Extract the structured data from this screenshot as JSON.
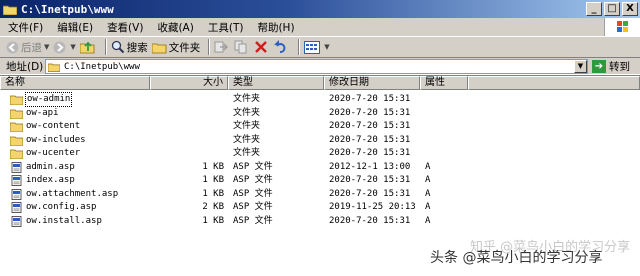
{
  "window": {
    "title": "C:\\Inetpub\\www",
    "minimize": "_",
    "maximize": "□",
    "close": "X"
  },
  "menu": [
    "文件(F)",
    "编辑(E)",
    "查看(V)",
    "收藏(A)",
    "工具(T)",
    "帮助(H)"
  ],
  "toolbar": {
    "back": "后退",
    "search": "搜索",
    "folders": "文件夹"
  },
  "address": {
    "label": "地址(D)",
    "value": "C:\\Inetpub\\www",
    "go": "转到"
  },
  "columns": {
    "name": "名称",
    "size": "大小",
    "type": "类型",
    "date": "修改日期",
    "attr": "属性"
  },
  "files": [
    {
      "name": "ow-admin",
      "size": "",
      "type": "文件夹",
      "date": "2020-7-20 15:31",
      "attr": "",
      "icon": "folder-icon"
    },
    {
      "name": "ow-api",
      "size": "",
      "type": "文件夹",
      "date": "2020-7-20 15:31",
      "attr": "",
      "icon": "folder-icon"
    },
    {
      "name": "ow-content",
      "size": "",
      "type": "文件夹",
      "date": "2020-7-20 15:31",
      "attr": "",
      "icon": "folder-icon"
    },
    {
      "name": "ow-includes",
      "size": "",
      "type": "文件夹",
      "date": "2020-7-20 15:31",
      "attr": "",
      "icon": "folder-icon"
    },
    {
      "name": "ow-ucenter",
      "size": "",
      "type": "文件夹",
      "date": "2020-7-20 15:31",
      "attr": "",
      "icon": "folder-icon"
    },
    {
      "name": "admin.asp",
      "size": "1 KB",
      "type": "ASP 文件",
      "date": "2012-12-1 13:00",
      "attr": "A",
      "icon": "asp-file-icon"
    },
    {
      "name": "index.asp",
      "size": "1 KB",
      "type": "ASP 文件",
      "date": "2020-7-20 15:31",
      "attr": "A",
      "icon": "asp-file-icon"
    },
    {
      "name": "ow.attachment.asp",
      "size": "1 KB",
      "type": "ASP 文件",
      "date": "2020-7-20 15:31",
      "attr": "A",
      "icon": "asp-file-icon"
    },
    {
      "name": "ow.config.asp",
      "size": "2 KB",
      "type": "ASP 文件",
      "date": "2019-11-25 20:13",
      "attr": "A",
      "icon": "asp-file-icon"
    },
    {
      "name": "ow.install.asp",
      "size": "1 KB",
      "type": "ASP 文件",
      "date": "2020-7-20 15:31",
      "attr": "A",
      "icon": "asp-file-icon"
    }
  ],
  "watermark": {
    "main": "头条 @菜鸟小白的学习分享",
    "faint": "知乎 @菜鸟小白的学习分享"
  },
  "colors": {
    "titlebar_start": "#0a246a",
    "titlebar_end": "#a6caf0",
    "chrome": "#d4d0c8",
    "folder": "#f5d56b"
  }
}
